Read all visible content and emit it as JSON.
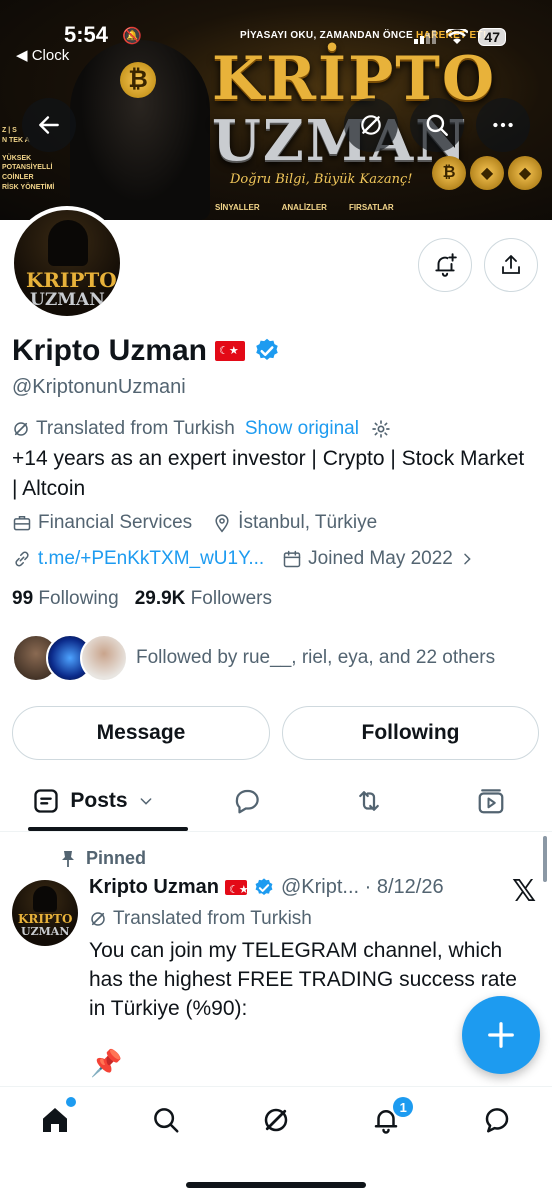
{
  "status_bar": {
    "time": "5:54",
    "back_app": "◀ Clock",
    "battery": "47"
  },
  "banner": {
    "tagline_prefix": "PİYASAYI OKU, ZAMANDAN ÖNCE ",
    "tagline_highlight": "HAREKET ET!",
    "word1": "KRİPTO",
    "word2": "UZMAN",
    "slogan": "Doğru Bilgi, Büyük Kazanç!",
    "strip": [
      "SİNYALLER",
      "ANALİZLER",
      "FIRSATLAR"
    ],
    "left_panel": [
      "Z | S",
      "N TEK A",
      "YÜKSEK POTANSİYELLİ COİNLER",
      "RİSK YÖNETİMİ"
    ],
    "avatar_word1": "KRIPTO",
    "avatar_word2": "UZMAN"
  },
  "profile": {
    "name": "Kripto Uzman",
    "handle": "@KriptonunUzmani",
    "translated_label": "Translated from Turkish",
    "show_original": "Show original",
    "bio": "+14 years as an expert investor | Crypto | Stock Market | Altcoin",
    "category": "Financial Services",
    "location": "İstanbul, Türkiye",
    "link": "t.me/+PEnKkTXM_wU1Y...",
    "joined": "Joined May 2022",
    "following_count": "99",
    "following_label": "Following",
    "followers_count": "29.9K",
    "followers_label": "Followers",
    "followed_by": "Followed by rue__, riel, eya, and 22 others"
  },
  "actions": {
    "message": "Message",
    "following": "Following"
  },
  "tabs": {
    "posts": "Posts"
  },
  "post": {
    "pinned_label": "Pinned",
    "author": "Kripto Uzman",
    "handle_date": "@Kript... · 8/12/26",
    "translated_label": "Translated from Turkish",
    "text": "You can join my TELEGRAM channel, which has the highest FREE TRADING success rate in Türkiye (%90):",
    "emoji": "📌"
  },
  "nav": {
    "notifications_badge": "1"
  },
  "colors": {
    "accent": "#1d9bf0",
    "text": "#0f1419",
    "muted": "#536471",
    "border": "#cfd9de"
  }
}
